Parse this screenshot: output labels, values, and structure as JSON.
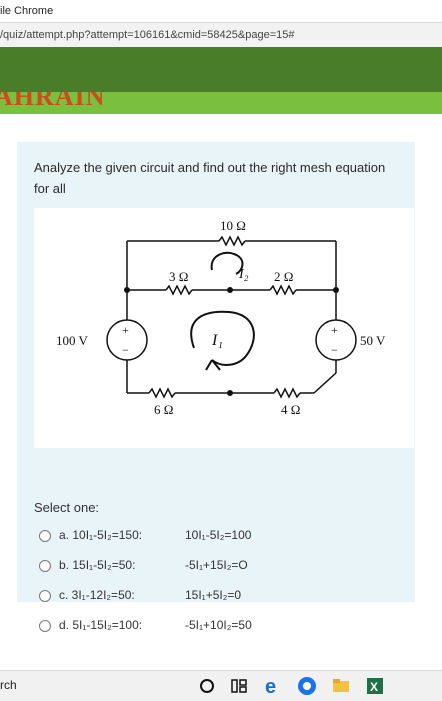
{
  "window": {
    "title_fragment": "ile Chrome"
  },
  "address": {
    "url_fragment": "/quiz/attempt.php?attempt=106161&cmid=58425&page=15#"
  },
  "brand": {
    "text": "AHRAIN"
  },
  "question": {
    "prompt": "Analyze the given circuit and find out the right  mesh equation for all",
    "select_label": "Select one:"
  },
  "circuit": {
    "r_top": "10 Ω",
    "r_left_mid": "3 Ω",
    "r_right_mid": "2 Ω",
    "r_bottom_left": "6 Ω",
    "r_bottom_right": "4 Ω",
    "source_left": "100 V",
    "source_right": "50 V",
    "plus": "+",
    "minus": "−",
    "annot_i1": "I₁",
    "annot_i2": "I₂"
  },
  "options": [
    {
      "letter_text": "a. 10I₁-5I₂=150:",
      "second_text": "10I₁-5I₂=100"
    },
    {
      "letter_text": "b. 15I₁-5I₂=50:",
      "second_text": "-5I₁+15I₂=O"
    },
    {
      "letter_text": "c. 3I₁-12I₂=50:",
      "second_text": "15I₁+5I₂=0"
    },
    {
      "letter_text": "d. 5I₁-15I₂=100:",
      "second_text": "-5I₁+10I₂=50"
    }
  ],
  "taskbar": {
    "search_text": "rch",
    "icons": [
      "cortana-icon",
      "task-view-icon",
      "edge-icon",
      "chrome-icon",
      "file-explorer-icon",
      "excel-icon"
    ]
  }
}
